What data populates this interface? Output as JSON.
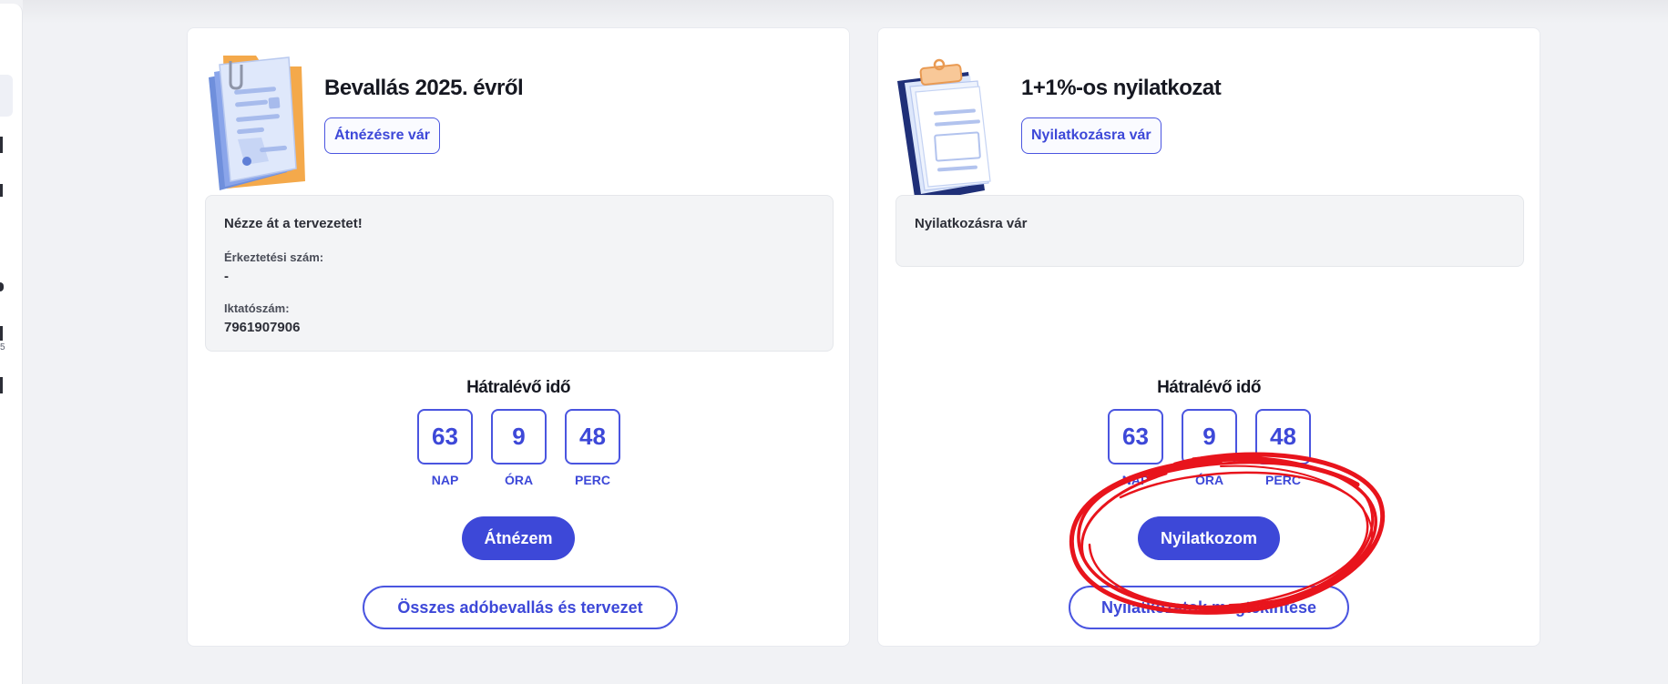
{
  "colors": {
    "accent": "#3d48d8",
    "page_background": "#f1f2f5",
    "card_background": "#ffffff",
    "info_box_background": "#f3f4f6",
    "annotation": "#e8141c"
  },
  "sidebar": {
    "tiny_digit": "5"
  },
  "cards": [
    {
      "title": "Bevallás 2025. évről",
      "status_badge": "Átnézésre vár",
      "illustration_icon": "tax-return-documents-icon",
      "info": {
        "title": "Nézze át a tervezetet!",
        "fields": [
          {
            "label": "Érkeztetési szám:",
            "value": "-"
          },
          {
            "label": "Iktatószám:",
            "value": "7961907906"
          }
        ]
      },
      "countdown": {
        "title": "Hátralévő idő",
        "days": "63",
        "days_label": "NAP",
        "hours": "9",
        "hours_label": "ÓRA",
        "minutes": "48",
        "minutes_label": "PERC"
      },
      "primary_button": "Átnézem",
      "secondary_button": "Összes adóbevallás és tervezet"
    },
    {
      "title": "1+1%-os nyilatkozat",
      "status_badge": "Nyilatkozásra vár",
      "illustration_icon": "clipboard-form-icon",
      "info": {
        "title": "Nyilatkozásra vár",
        "fields": []
      },
      "countdown": {
        "title": "Hátralévő idő",
        "days": "63",
        "days_label": "NAP",
        "hours": "9",
        "hours_label": "ÓRA",
        "minutes": "48",
        "minutes_label": "PERC"
      },
      "primary_button": "Nyilatkozom",
      "secondary_button": "Nyilatkozatok megtekintése"
    }
  ]
}
